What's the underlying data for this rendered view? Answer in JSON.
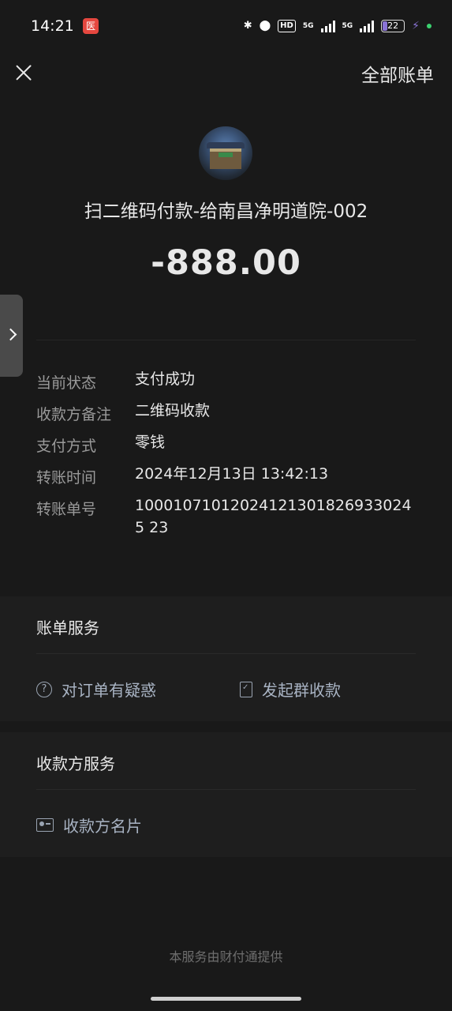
{
  "status_bar": {
    "time": "14:21",
    "app_badge": "医",
    "network_1": "5G",
    "network_2": "5G",
    "hd_label": "HD",
    "battery": "22",
    "battery_level": 0.22,
    "icons": [
      "bluetooth-icon",
      "location-icon",
      "hd-icon",
      "signal-icon",
      "signal-icon",
      "battery-icon",
      "charging-icon"
    ]
  },
  "header": {
    "close_icon": "close-icon",
    "all_bills_label": "全部账单"
  },
  "transaction": {
    "payee_title": "扫二维码付款-给南昌净明道院-002",
    "amount": "-888.00"
  },
  "details": [
    {
      "label": "当前状态",
      "value": "支付成功"
    },
    {
      "label": "收款方备注",
      "value": "二维码收款"
    },
    {
      "label": "支付方式",
      "value": "零钱"
    },
    {
      "label": "转账时间",
      "value": "2024年12月13日 13:42:13"
    },
    {
      "label": "转账单号",
      "value": "100010710120241213018269330245 23"
    }
  ],
  "bill_services": {
    "title": "账单服务",
    "items": [
      {
        "label": "对订单有疑惑",
        "icon": "question-icon"
      },
      {
        "label": "发起群收款",
        "icon": "document-check-icon"
      }
    ]
  },
  "payee_services": {
    "title": "收款方服务",
    "items": [
      {
        "label": "收款方名片",
        "icon": "contact-card-icon"
      }
    ]
  },
  "footer": {
    "text": "本服务由财付通提供"
  },
  "colors": {
    "background": "#191919",
    "section_background": "#1e1e1e",
    "label_gray": "#9a9a9a",
    "service_link": "#a9b4c4"
  }
}
